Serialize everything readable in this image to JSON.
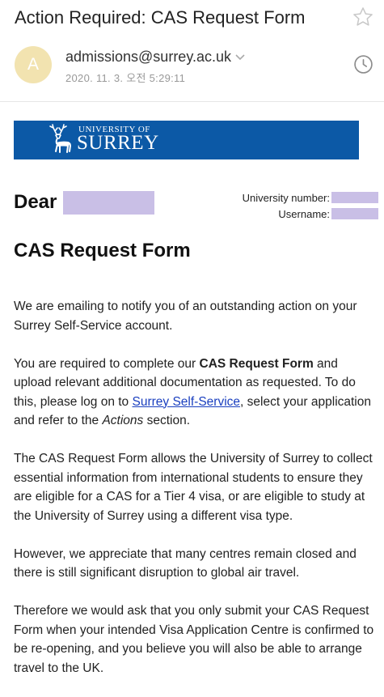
{
  "email": {
    "subject": "Action Required: CAS Request Form",
    "avatar_letter": "A",
    "sender": "admissions@surrey.ac.uk",
    "date": "2020. 11. 3. 오전 5:29:11"
  },
  "banner": {
    "logo_small": "UNIVERSITY OF",
    "logo_big": "SURREY",
    "color": "#0c59a6"
  },
  "body": {
    "greeting": "Dear",
    "university_number_label": "University number:",
    "username_label": "Username:",
    "form_title": "CAS Request Form",
    "p1": "We are emailing to notify you of an outstanding action on your Surrey Self-Service account.",
    "p2_a": "You are required to complete our ",
    "p2_bold": "CAS Request Form",
    "p2_b": " and upload relevant additional documentation as requested. To do this, please log on to ",
    "p2_link": "Surrey Self-Service",
    "p2_c": ", select your application and refer to the ",
    "p2_italic": "Actions",
    "p2_d": " section.",
    "p3": "The CAS Request Form allows the University of Surrey to collect essential information from international students to ensure they are eligible for a CAS for a Tier 4 visa, or are eligible to study at the University of Surrey using a different visa type.",
    "p4": "However, we appreciate that many centres remain closed and there is still significant disruption to global air travel.",
    "p5": "Therefore we would ask that you only submit your CAS Request Form when your intended Visa Application Centre is confirmed to be re-opening, and you believe you will also be able to arrange travel to the UK."
  },
  "icons": {
    "star": "star-icon",
    "clock": "clock-icon",
    "chevron": "chevron-down-icon",
    "logo": "stag-logo"
  }
}
